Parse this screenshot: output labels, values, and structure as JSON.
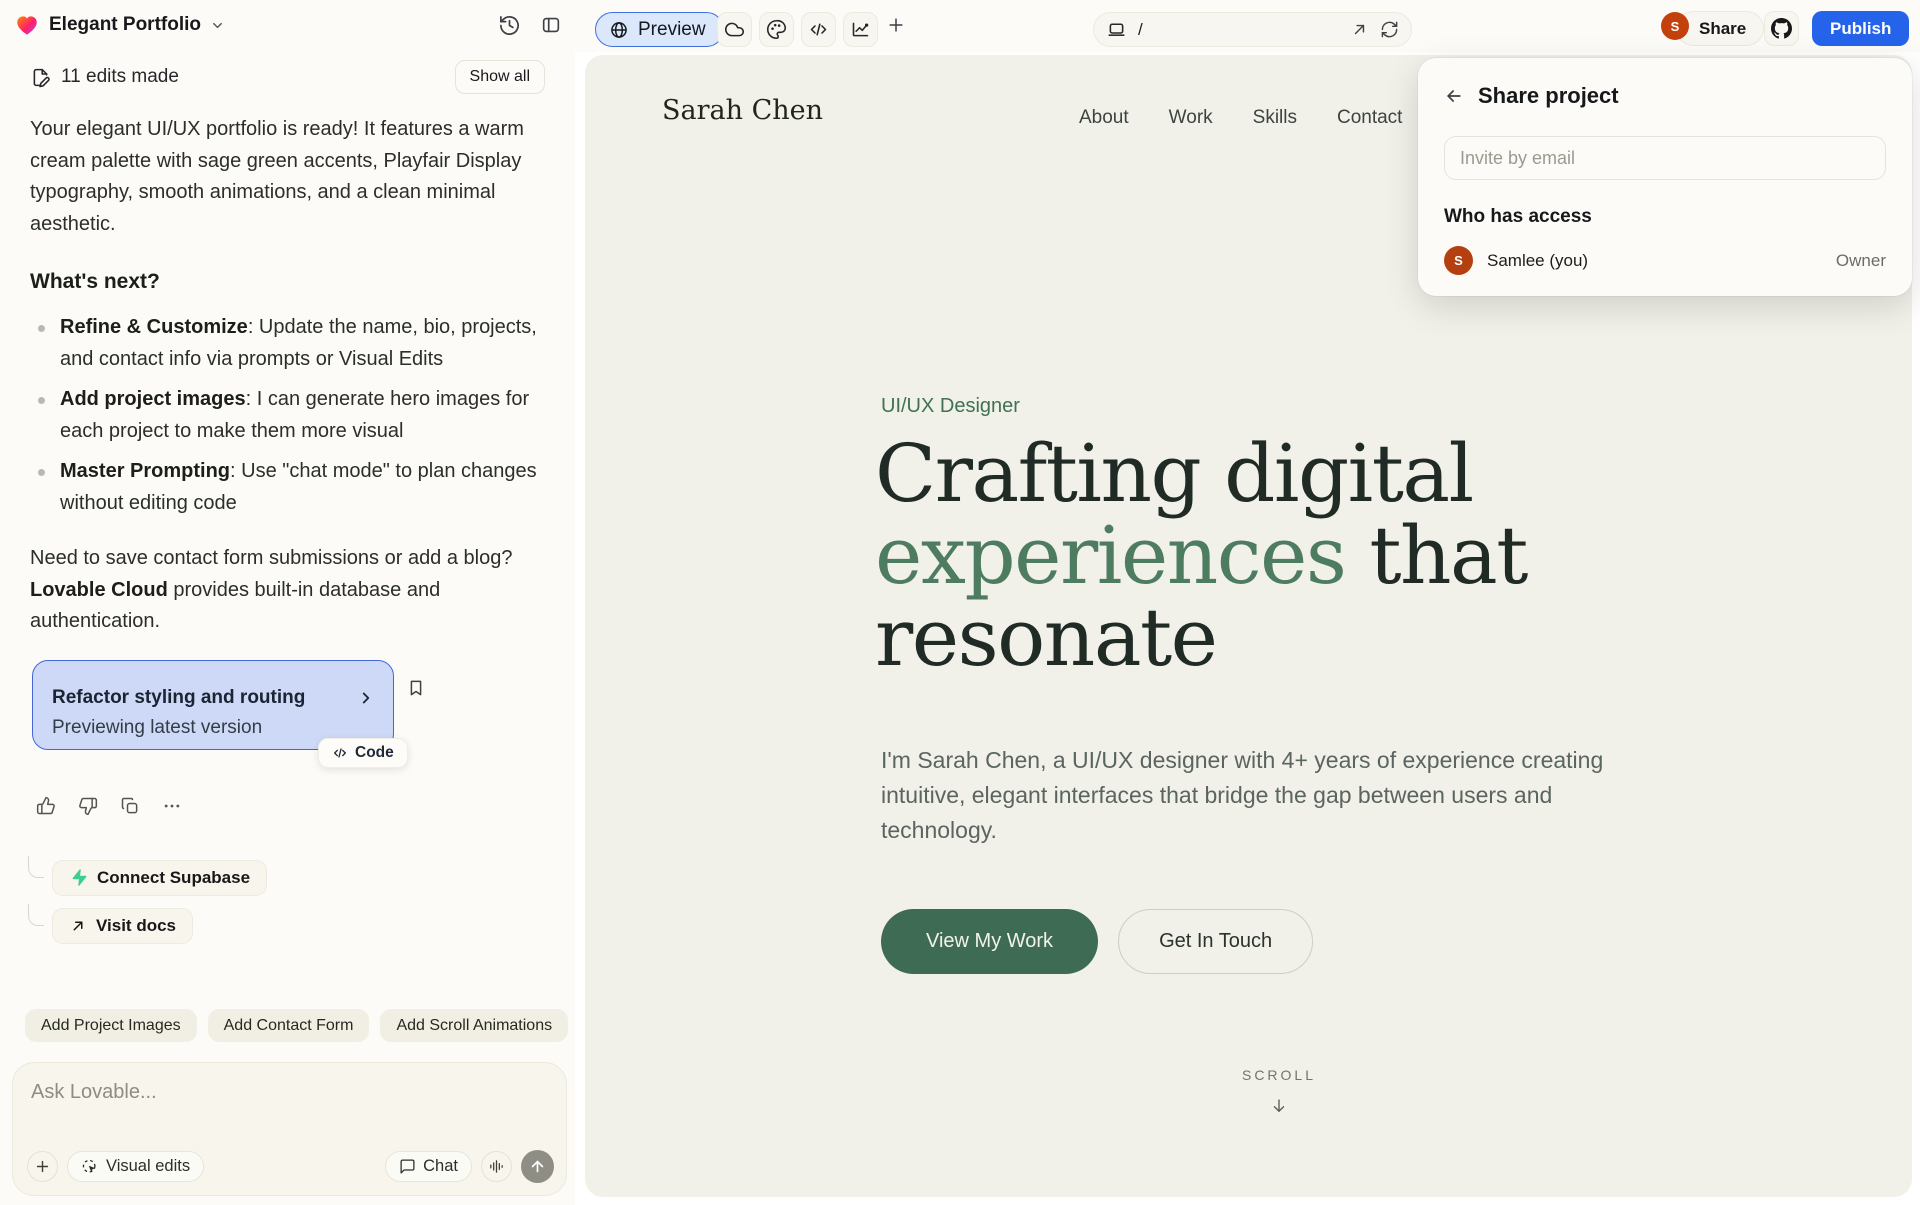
{
  "topbar": {
    "project_name": "Elegant Portfolio",
    "preview_label": "Preview",
    "url_path": "/",
    "share_label": "Share",
    "publish_label": "Publish",
    "avatar_initial": "S"
  },
  "sidebar": {
    "edits_summary": "11 edits made",
    "show_all_label": "Show all",
    "intro": "Your elegant UI/UX portfolio is ready! It features a warm cream palette with sage green accents, Playfair Display typography, smooth animations, and a clean minimal aesthetic.",
    "whats_next_heading": "What's next?",
    "bullets": [
      {
        "bold": "Refine & Customize",
        "rest": ": Update the name, bio, projects, and contact info via prompts or Visual Edits"
      },
      {
        "bold": "Add project images",
        "rest": ": I can generate hero images for each project to make them more visual"
      },
      {
        "bold": "Master Prompting",
        "rest": ": Use \"chat mode\" to plan changes without editing code"
      }
    ],
    "note": {
      "pre": "Need to save contact form submissions or add a blog? ",
      "bold": "Lovable Cloud",
      "post": " provides built-in database and authentication."
    },
    "version_card": {
      "title": "Refactor styling and routing",
      "status": "Previewing latest version"
    },
    "code_button_label": "Code",
    "connect_supabase_label": "Connect Supabase",
    "visit_docs_label": "Visit docs",
    "chips": [
      "Add Project Images",
      "Add Contact Form",
      "Add Scroll Animations"
    ],
    "ask_placeholder": "Ask Lovable...",
    "visual_edits_label": "Visual edits",
    "chat_mode_label": "Chat"
  },
  "share_popover": {
    "title": "Share project",
    "invite_placeholder": "Invite by email",
    "access_heading": "Who has access",
    "member": {
      "initial": "S",
      "name": "Samlee (you)",
      "role": "Owner"
    }
  },
  "site": {
    "logo": "Sarah Chen",
    "nav": [
      "About",
      "Work",
      "Skills",
      "Contact"
    ],
    "hero_label": "UI/UX Designer",
    "heading": {
      "line1": "Crafting digital",
      "line2_accent": "experiences",
      "line2_rest": " that",
      "line3": "resonate"
    },
    "bio": "I'm Sarah Chen, a UI/UX designer with 4+ years of experience creating intuitive, elegant interfaces that bridge the gap between users and technology.",
    "cta_primary": "View My Work",
    "cta_secondary": "Get In Touch",
    "scroll_label": "SCROLL"
  },
  "colors": {
    "accent_blue": "#2563eb",
    "selection_blue_bg": "#cdd9f6",
    "selection_blue_border": "#4167d8",
    "sage_green": "#4e7c61",
    "forest_button_green": "#3d6b53",
    "avatar_orange": "#c2410c",
    "supabase_green": "#3ecf8e",
    "site_background": "#f1f0e9",
    "panel_background": "#fcfbf7"
  }
}
